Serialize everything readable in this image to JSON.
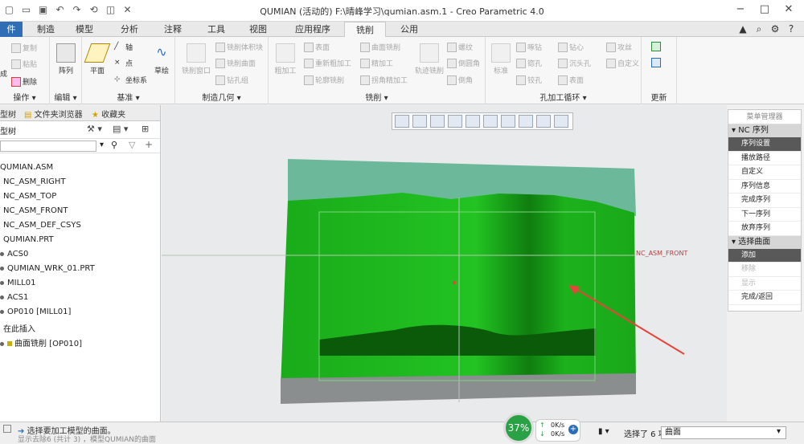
{
  "window": {
    "title": "QUMIAN (活动的) F:\\晴峰学习\\qumian.asm.1 - Creo Parametric 4.0"
  },
  "tabs": [
    {
      "label": "件"
    },
    {
      "label": "制造"
    },
    {
      "label": "模型"
    },
    {
      "label": "分析"
    },
    {
      "label": "注释"
    },
    {
      "label": "工具"
    },
    {
      "label": "视图"
    },
    {
      "label": "应用程序"
    },
    {
      "label": "铣削"
    },
    {
      "label": "公用"
    }
  ],
  "ribbon": {
    "ops": {
      "copy": "复制",
      "paste": "粘贴",
      "cut_label": "成",
      "delete": "删除",
      "group": "操作"
    },
    "edit": {
      "array": "阵列",
      "group": "编辑"
    },
    "datum": {
      "plane": "平面",
      "axis": "轴",
      "point": "点",
      "csys": "坐标系",
      "sketch": "草绘",
      "group": "基准"
    },
    "mfg": {
      "mill_window": "铣削窗口",
      "mill_volume": "铣削体积块",
      "mill_surface": "铣削曲面",
      "drill_group": "钻孔组",
      "group": "制造几何"
    },
    "mill": {
      "rough": "粗加工",
      "surface": "表面",
      "rerough": "重新粗加工",
      "contour": "轮廓铣削",
      "surface_mill": "曲面铣削",
      "finish": "精加工",
      "corner_finish": "拐角精加工",
      "trajectory": "轨迹铣削",
      "thread": "螺纹",
      "chamfer": "倒圆角",
      "round": "倒角",
      "group": "铣削"
    },
    "holemaking": {
      "standard": "标准",
      "spot": "啄钻",
      "countersink": "锪孔",
      "ream": "铰孔",
      "center": "钻心",
      "counterbore": "沉头孔",
      "face": "表面",
      "tap": "攻丝",
      "custom": "自定义",
      "group": "孔加工循环"
    },
    "update": {
      "group": "更新"
    }
  },
  "left_panel": {
    "tabs": {
      "tree": "型树",
      "folder": "文件夹浏览器",
      "favorites": "收藏夹"
    },
    "tree_label": "型树",
    "items": [
      "QUMIAN.ASM",
      "NC_ASM_RIGHT",
      "NC_ASM_TOP",
      "NC_ASM_FRONT",
      "NC_ASM_DEF_CSYS",
      "QUMIAN.PRT",
      "ACS0",
      "QUMIAN_WRK_01.PRT",
      "MILL01",
      "ACS1",
      "OP010 [MILL01]",
      "在此插入",
      "曲面铣削 [OP010]"
    ]
  },
  "viewport": {
    "front_label": "NC_ASM_FRONT"
  },
  "menu_manager": {
    "title": "菜单管理器",
    "sec1_header": "NC 序列",
    "sec1_items": [
      "序列设置",
      "播放路径",
      "自定义",
      "序列信息",
      "完成序列",
      "下一序列",
      "放弃序列"
    ],
    "sec2_header": "选择曲面",
    "sec2_items": [
      "添加",
      "移除",
      "显示",
      "完成/返回"
    ]
  },
  "status": {
    "msg1": "选择要加工模型的曲面。",
    "msg2": "显示去除6 (共计 3) ，模型QUMIAN的曲面",
    "percent": "37%",
    "net_up": "0K/s",
    "net_down": "0K/s",
    "selected": "选择了 6 项",
    "filter": "曲面"
  },
  "colors": {
    "accent": "#2f6db5",
    "model_green": "#1fb51f",
    "model_dark": "#0a5a0a",
    "arrow_red": "#e8443a"
  }
}
